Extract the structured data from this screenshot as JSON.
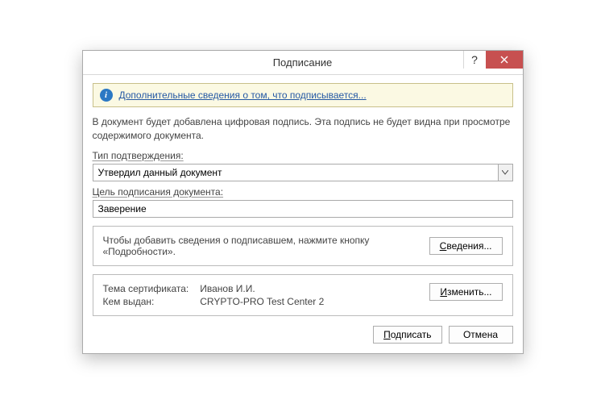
{
  "titlebar": {
    "title": "Подписание"
  },
  "info": {
    "link_text": "Дополнительные сведения о том, что подписывается..."
  },
  "description": "В документ будет добавлена цифровая подпись. Эта подпись не будет видна при просмотре содержимого документа.",
  "fields": {
    "type_label": "Тип подтверждения:",
    "type_value": "Утвердил данный документ",
    "purpose_label": "Цель подписания документа:",
    "purpose_value": "Заверение"
  },
  "details_box": {
    "text": "Чтобы добавить сведения о подписавшем, нажмите кнопку «Подробности».",
    "button": "Сведения..."
  },
  "cert": {
    "subject_label": "Тема сертификата:",
    "subject_value": "Иванов И.И.",
    "issuer_label": "Кем выдан:",
    "issuer_value": "CRYPTO-PRO Test Center 2",
    "change_button": "Изменить..."
  },
  "footer": {
    "sign": "Подписать",
    "cancel": "Отмена"
  }
}
